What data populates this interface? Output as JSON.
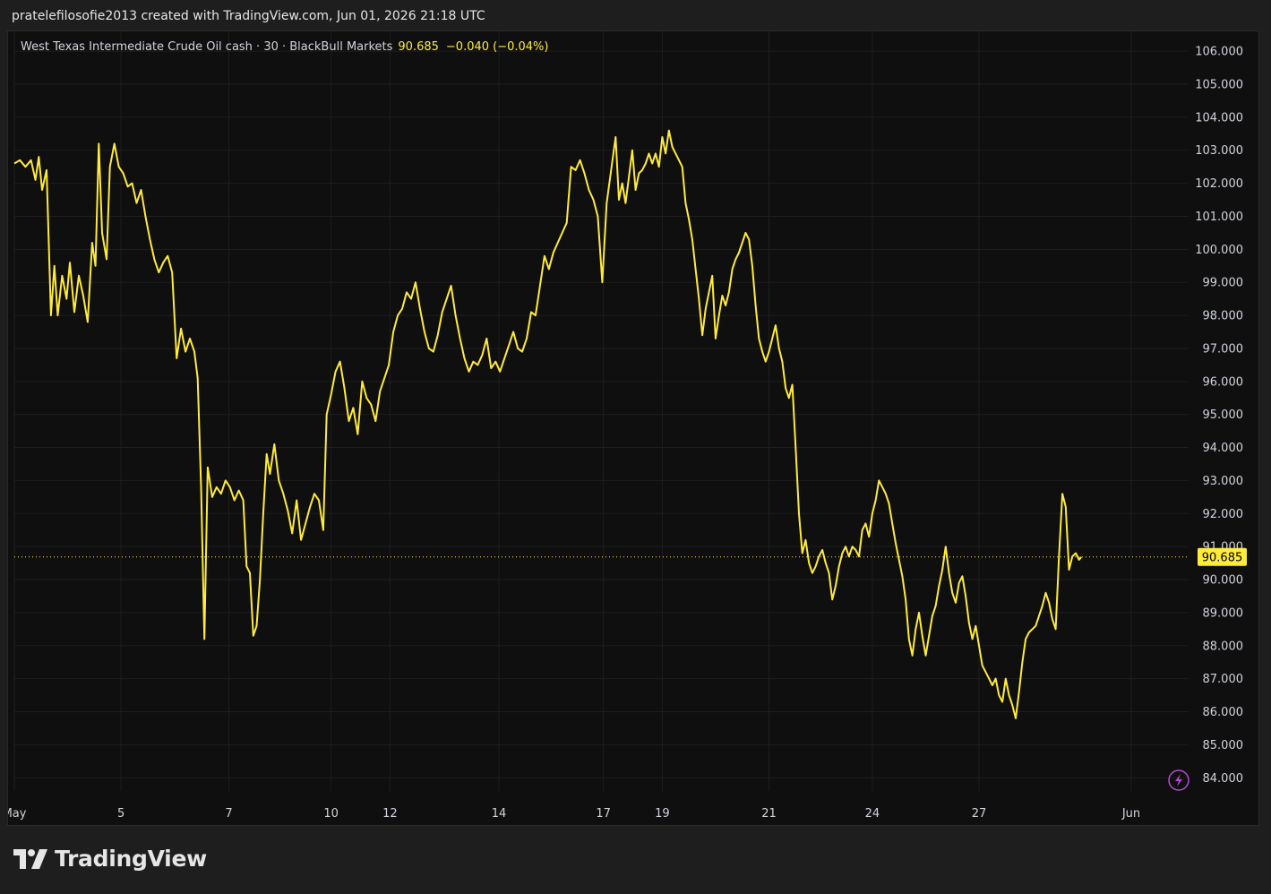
{
  "header": {
    "text": "pratelefilosofie2013 created with TradingView.com, Jun 01, 2026 21:18 UTC"
  },
  "legend": {
    "symbol": "West Texas Intermediate Crude Oil cash · 30 · BlackBull Markets",
    "price": "90.685",
    "change": "−0.040 (−0.04%)"
  },
  "brand": {
    "name": "TradingView",
    "logo_icon": "tradingview-logo-icon"
  },
  "colors": {
    "line": "#ffeb3b",
    "background": "#0f0f0f",
    "grid": "#1f1f1f",
    "price_label_bg": "#ffeb3b",
    "price_label_text": "#000000",
    "axis_text": "#d1d4dc",
    "flash_icon": "#b24bd6"
  },
  "chart_data": {
    "type": "line",
    "title": "",
    "xlabel": "",
    "ylabel": "",
    "ylim": [
      83.6,
      106.6
    ],
    "grid": true,
    "last_price": 90.685,
    "last_price_label": "90.685",
    "y_ticks": [
      84,
      85,
      86,
      87,
      88,
      89,
      90,
      91,
      92,
      93,
      94,
      95,
      96,
      97,
      98,
      99,
      100,
      101,
      102,
      103,
      104,
      105,
      106
    ],
    "y_tick_labels": [
      "84.000",
      "85.000",
      "86.000",
      "87.000",
      "88.000",
      "89.000",
      "90.000",
      "91.000",
      "92.000",
      "93.000",
      "94.000",
      "95.000",
      "96.000",
      "97.000",
      "98.000",
      "99.000",
      "100.000",
      "101.000",
      "102.000",
      "103.000",
      "104.000",
      "105.000",
      "106.000"
    ],
    "x_ticks": [
      {
        "label": "May",
        "t": 0.0
      },
      {
        "label": "5",
        "t": 9.6
      },
      {
        "label": "7",
        "t": 19.3
      },
      {
        "label": "10",
        "t": 28.5
      },
      {
        "label": "12",
        "t": 33.8
      },
      {
        "label": "14",
        "t": 43.6
      },
      {
        "label": "17",
        "t": 53.0
      },
      {
        "label": "19",
        "t": 58.3
      },
      {
        "label": "21",
        "t": 67.9
      },
      {
        "label": "24",
        "t": 77.2
      },
      {
        "label": "27",
        "t": 86.8
      },
      {
        "label": "Jun",
        "t": 100.5
      }
    ],
    "series": [
      {
        "values": [
          [
            0.0,
            102.6
          ],
          [
            0.5,
            102.7
          ],
          [
            1.0,
            102.5
          ],
          [
            1.5,
            102.7
          ],
          [
            1.9,
            102.1
          ],
          [
            2.2,
            102.8
          ],
          [
            2.5,
            101.8
          ],
          [
            2.9,
            102.4
          ],
          [
            3.3,
            98.0
          ],
          [
            3.6,
            99.5
          ],
          [
            3.9,
            98.0
          ],
          [
            4.3,
            99.2
          ],
          [
            4.7,
            98.5
          ],
          [
            5.0,
            99.6
          ],
          [
            5.4,
            98.1
          ],
          [
            5.8,
            99.2
          ],
          [
            6.2,
            98.6
          ],
          [
            6.6,
            97.8
          ],
          [
            7.0,
            100.2
          ],
          [
            7.3,
            99.5
          ],
          [
            7.6,
            103.2
          ],
          [
            7.9,
            100.5
          ],
          [
            8.3,
            99.7
          ],
          [
            8.6,
            102.5
          ],
          [
            9.0,
            103.2
          ],
          [
            9.4,
            102.5
          ],
          [
            9.8,
            102.3
          ],
          [
            10.2,
            101.9
          ],
          [
            10.6,
            102.0
          ],
          [
            11.0,
            101.4
          ],
          [
            11.4,
            101.8
          ],
          [
            11.8,
            101.0
          ],
          [
            12.2,
            100.3
          ],
          [
            12.6,
            99.7
          ],
          [
            13.0,
            99.3
          ],
          [
            13.4,
            99.6
          ],
          [
            13.8,
            99.8
          ],
          [
            14.2,
            99.3
          ],
          [
            14.6,
            96.7
          ],
          [
            15.0,
            97.6
          ],
          [
            15.4,
            96.9
          ],
          [
            15.8,
            97.3
          ],
          [
            16.2,
            96.9
          ],
          [
            16.5,
            96.1
          ],
          [
            16.8,
            92.8
          ],
          [
            17.1,
            88.2
          ],
          [
            17.4,
            93.4
          ],
          [
            17.8,
            92.5
          ],
          [
            18.2,
            92.8
          ],
          [
            18.6,
            92.6
          ],
          [
            19.0,
            93.0
          ],
          [
            19.4,
            92.8
          ],
          [
            19.8,
            92.4
          ],
          [
            20.2,
            92.7
          ],
          [
            20.6,
            92.4
          ],
          [
            20.9,
            90.4
          ],
          [
            21.2,
            90.2
          ],
          [
            21.5,
            88.3
          ],
          [
            21.8,
            88.6
          ],
          [
            22.1,
            90.0
          ],
          [
            22.4,
            92.0
          ],
          [
            22.7,
            93.8
          ],
          [
            23.0,
            93.2
          ],
          [
            23.4,
            94.1
          ],
          [
            23.8,
            93.0
          ],
          [
            24.2,
            92.6
          ],
          [
            24.6,
            92.1
          ],
          [
            25.0,
            91.4
          ],
          [
            25.4,
            92.4
          ],
          [
            25.8,
            91.2
          ],
          [
            26.2,
            91.7
          ],
          [
            26.6,
            92.2
          ],
          [
            27.0,
            92.6
          ],
          [
            27.4,
            92.4
          ],
          [
            27.8,
            91.5
          ],
          [
            28.1,
            95.0
          ],
          [
            28.5,
            95.6
          ],
          [
            28.9,
            96.3
          ],
          [
            29.3,
            96.6
          ],
          [
            29.7,
            95.8
          ],
          [
            30.1,
            94.8
          ],
          [
            30.5,
            95.2
          ],
          [
            30.9,
            94.4
          ],
          [
            31.3,
            96.0
          ],
          [
            31.7,
            95.5
          ],
          [
            32.1,
            95.3
          ],
          [
            32.5,
            94.8
          ],
          [
            32.9,
            95.7
          ],
          [
            33.3,
            96.1
          ],
          [
            33.7,
            96.5
          ],
          [
            34.1,
            97.5
          ],
          [
            34.5,
            98.0
          ],
          [
            34.9,
            98.2
          ],
          [
            35.3,
            98.7
          ],
          [
            35.7,
            98.5
          ],
          [
            36.1,
            99.0
          ],
          [
            36.5,
            98.2
          ],
          [
            36.9,
            97.5
          ],
          [
            37.3,
            97.0
          ],
          [
            37.7,
            96.9
          ],
          [
            38.1,
            97.4
          ],
          [
            38.5,
            98.1
          ],
          [
            38.9,
            98.5
          ],
          [
            39.3,
            98.9
          ],
          [
            39.7,
            98.0
          ],
          [
            40.1,
            97.3
          ],
          [
            40.5,
            96.7
          ],
          [
            40.9,
            96.3
          ],
          [
            41.3,
            96.6
          ],
          [
            41.7,
            96.5
          ],
          [
            42.1,
            96.8
          ],
          [
            42.5,
            97.3
          ],
          [
            42.9,
            96.4
          ],
          [
            43.3,
            96.6
          ],
          [
            43.7,
            96.3
          ],
          [
            44.1,
            96.7
          ],
          [
            44.5,
            97.1
          ],
          [
            44.9,
            97.5
          ],
          [
            45.3,
            97.0
          ],
          [
            45.7,
            96.9
          ],
          [
            46.1,
            97.3
          ],
          [
            46.5,
            98.1
          ],
          [
            46.9,
            98.0
          ],
          [
            47.3,
            98.9
          ],
          [
            47.7,
            99.8
          ],
          [
            48.1,
            99.4
          ],
          [
            48.5,
            99.9
          ],
          [
            48.9,
            100.2
          ],
          [
            49.3,
            100.5
          ],
          [
            49.7,
            100.8
          ],
          [
            50.1,
            102.5
          ],
          [
            50.5,
            102.4
          ],
          [
            50.9,
            102.7
          ],
          [
            51.3,
            102.3
          ],
          [
            51.7,
            101.8
          ],
          [
            52.1,
            101.5
          ],
          [
            52.5,
            101.0
          ],
          [
            52.9,
            99.0
          ],
          [
            53.3,
            101.4
          ],
          [
            53.7,
            102.4
          ],
          [
            54.1,
            103.4
          ],
          [
            54.4,
            101.5
          ],
          [
            54.7,
            102.0
          ],
          [
            55.0,
            101.4
          ],
          [
            55.3,
            102.2
          ],
          [
            55.6,
            103.0
          ],
          [
            55.9,
            101.8
          ],
          [
            56.2,
            102.3
          ],
          [
            56.5,
            102.4
          ],
          [
            56.8,
            102.6
          ],
          [
            57.1,
            102.9
          ],
          [
            57.4,
            102.6
          ],
          [
            57.7,
            102.9
          ],
          [
            58.0,
            102.5
          ],
          [
            58.3,
            103.4
          ],
          [
            58.6,
            102.9
          ],
          [
            58.9,
            103.6
          ],
          [
            59.2,
            103.1
          ],
          [
            59.5,
            102.9
          ],
          [
            59.8,
            102.7
          ],
          [
            60.1,
            102.5
          ],
          [
            60.4,
            101.4
          ],
          [
            60.7,
            100.9
          ],
          [
            61.0,
            100.3
          ],
          [
            61.3,
            99.4
          ],
          [
            61.6,
            98.5
          ],
          [
            61.9,
            97.4
          ],
          [
            62.2,
            98.2
          ],
          [
            62.5,
            98.7
          ],
          [
            62.8,
            99.2
          ],
          [
            63.1,
            97.3
          ],
          [
            63.4,
            98.0
          ],
          [
            63.7,
            98.6
          ],
          [
            64.0,
            98.3
          ],
          [
            64.3,
            98.7
          ],
          [
            64.6,
            99.4
          ],
          [
            64.9,
            99.7
          ],
          [
            65.2,
            99.9
          ],
          [
            65.5,
            100.2
          ],
          [
            65.8,
            100.5
          ],
          [
            66.1,
            100.3
          ],
          [
            66.4,
            99.5
          ],
          [
            66.7,
            98.3
          ],
          [
            67.0,
            97.3
          ],
          [
            67.3,
            96.9
          ],
          [
            67.6,
            96.6
          ],
          [
            67.9,
            96.9
          ],
          [
            68.2,
            97.3
          ],
          [
            68.5,
            97.7
          ],
          [
            68.8,
            97.0
          ],
          [
            69.1,
            96.6
          ],
          [
            69.4,
            95.8
          ],
          [
            69.7,
            95.5
          ],
          [
            70.0,
            95.9
          ],
          [
            70.3,
            94.0
          ],
          [
            70.6,
            92.0
          ],
          [
            70.9,
            90.8
          ],
          [
            71.2,
            91.2
          ],
          [
            71.5,
            90.5
          ],
          [
            71.8,
            90.2
          ],
          [
            72.1,
            90.4
          ],
          [
            72.4,
            90.7
          ],
          [
            72.7,
            90.9
          ],
          [
            73.0,
            90.5
          ],
          [
            73.3,
            90.2
          ],
          [
            73.6,
            89.4
          ],
          [
            73.9,
            89.8
          ],
          [
            74.2,
            90.4
          ],
          [
            74.5,
            90.8
          ],
          [
            74.8,
            91.0
          ],
          [
            75.1,
            90.7
          ],
          [
            75.4,
            91.0
          ],
          [
            75.7,
            90.9
          ],
          [
            76.0,
            90.7
          ],
          [
            76.3,
            91.5
          ],
          [
            76.6,
            91.7
          ],
          [
            76.9,
            91.3
          ],
          [
            77.2,
            92.0
          ],
          [
            77.5,
            92.4
          ],
          [
            77.8,
            93.0
          ],
          [
            78.1,
            92.8
          ],
          [
            78.4,
            92.6
          ],
          [
            78.7,
            92.3
          ],
          [
            79.0,
            91.7
          ],
          [
            79.3,
            91.1
          ],
          [
            79.6,
            90.6
          ],
          [
            79.9,
            90.1
          ],
          [
            80.2,
            89.4
          ],
          [
            80.5,
            88.2
          ],
          [
            80.8,
            87.7
          ],
          [
            81.1,
            88.5
          ],
          [
            81.4,
            89.0
          ],
          [
            81.7,
            88.3
          ],
          [
            82.0,
            87.7
          ],
          [
            82.3,
            88.3
          ],
          [
            82.6,
            88.9
          ],
          [
            82.9,
            89.2
          ],
          [
            83.2,
            89.8
          ],
          [
            83.5,
            90.3
          ],
          [
            83.8,
            91.0
          ],
          [
            84.1,
            90.2
          ],
          [
            84.4,
            89.6
          ],
          [
            84.7,
            89.3
          ],
          [
            85.0,
            89.9
          ],
          [
            85.3,
            90.1
          ],
          [
            85.6,
            89.5
          ],
          [
            85.9,
            88.7
          ],
          [
            86.2,
            88.2
          ],
          [
            86.5,
            88.6
          ],
          [
            86.8,
            88.0
          ],
          [
            87.1,
            87.4
          ],
          [
            87.4,
            87.2
          ],
          [
            87.7,
            87.0
          ],
          [
            88.0,
            86.8
          ],
          [
            88.3,
            87.0
          ],
          [
            88.6,
            86.5
          ],
          [
            88.9,
            86.3
          ],
          [
            89.2,
            87.0
          ],
          [
            89.5,
            86.5
          ],
          [
            89.8,
            86.2
          ],
          [
            90.1,
            85.8
          ],
          [
            90.4,
            86.6
          ],
          [
            90.7,
            87.5
          ],
          [
            91.0,
            88.2
          ],
          [
            91.3,
            88.4
          ],
          [
            91.6,
            88.5
          ],
          [
            91.9,
            88.6
          ],
          [
            92.2,
            88.9
          ],
          [
            92.5,
            89.2
          ],
          [
            92.8,
            89.6
          ],
          [
            93.1,
            89.3
          ],
          [
            93.4,
            88.8
          ],
          [
            93.7,
            88.5
          ],
          [
            94.0,
            90.7
          ],
          [
            94.3,
            92.6
          ],
          [
            94.6,
            92.2
          ],
          [
            94.9,
            90.3
          ],
          [
            95.2,
            90.7
          ],
          [
            95.5,
            90.8
          ],
          [
            95.8,
            90.6
          ],
          [
            96.0,
            90.685
          ]
        ]
      }
    ]
  }
}
